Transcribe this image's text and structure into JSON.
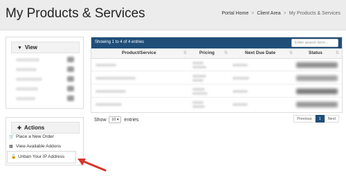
{
  "page": {
    "title": "My Products & Services"
  },
  "breadcrumb": {
    "items": [
      "Portal Home",
      "Client Area",
      "My Products & Services"
    ],
    "separator": ">"
  },
  "sidebar": {
    "view_panel": {
      "title": "View",
      "icon": "filter-icon",
      "items_obscured": 5
    },
    "actions_panel": {
      "title": "Actions",
      "icon": "plus-icon",
      "items": [
        {
          "label": "Place a New Order",
          "icon": "shopping-cart-icon"
        },
        {
          "label": "View Available Addons",
          "icon": "cubes-icon"
        },
        {
          "label": "Unban Your IP Address",
          "icon": "unlock-icon"
        }
      ]
    }
  },
  "table": {
    "info": "Showing 1 to 4 of 4 entries",
    "search_placeholder": "Enter search term...",
    "columns": [
      "Product/Service",
      "Pricing",
      "Next Due Date",
      "Status"
    ],
    "rows_obscured": 4
  },
  "footer": {
    "show_label": "Show",
    "page_size": "10",
    "entries_label": "entries",
    "pagination": {
      "previous": "Previous",
      "current": "1",
      "next": "Next"
    }
  },
  "colors": {
    "accent": "#1f4e79",
    "annotation_arrow": "#d9342b"
  }
}
